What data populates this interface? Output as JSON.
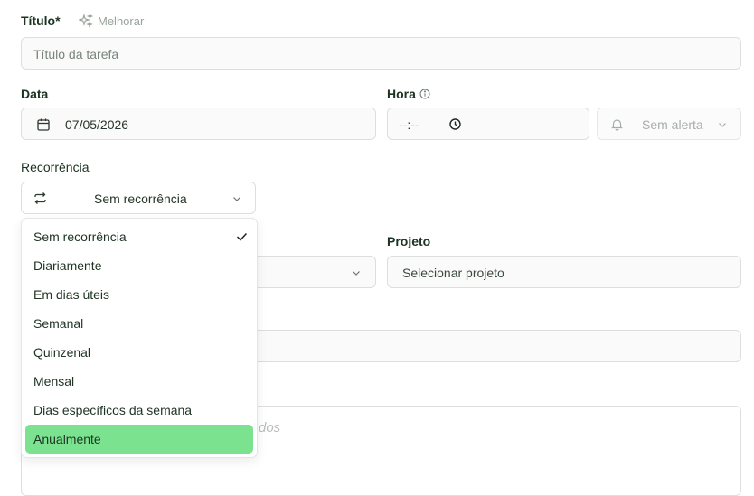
{
  "title": {
    "label": "Título*",
    "improve_label": "Melhorar",
    "placeholder": "Título da tarefa"
  },
  "date": {
    "label": "Data",
    "value": "07/05/2026"
  },
  "time": {
    "label": "Hora",
    "value": "--:--"
  },
  "alert": {
    "value": "Sem alerta"
  },
  "recurrence": {
    "label": "Recorrência",
    "selected": "Sem recorrência",
    "options": [
      "Sem recorrência",
      "Diariamente",
      "Em dias úteis",
      "Semanal",
      "Quinzenal",
      "Mensal",
      "Dias específicos da semana",
      "Anualmente"
    ]
  },
  "project": {
    "label": "Projeto",
    "placeholder": "Selecionar projeto"
  },
  "description": {
    "placeholder_fragment": "dos"
  },
  "colors": {
    "accent": "#7be38f",
    "text": "#1c3322",
    "border": "#dcdfdc"
  }
}
